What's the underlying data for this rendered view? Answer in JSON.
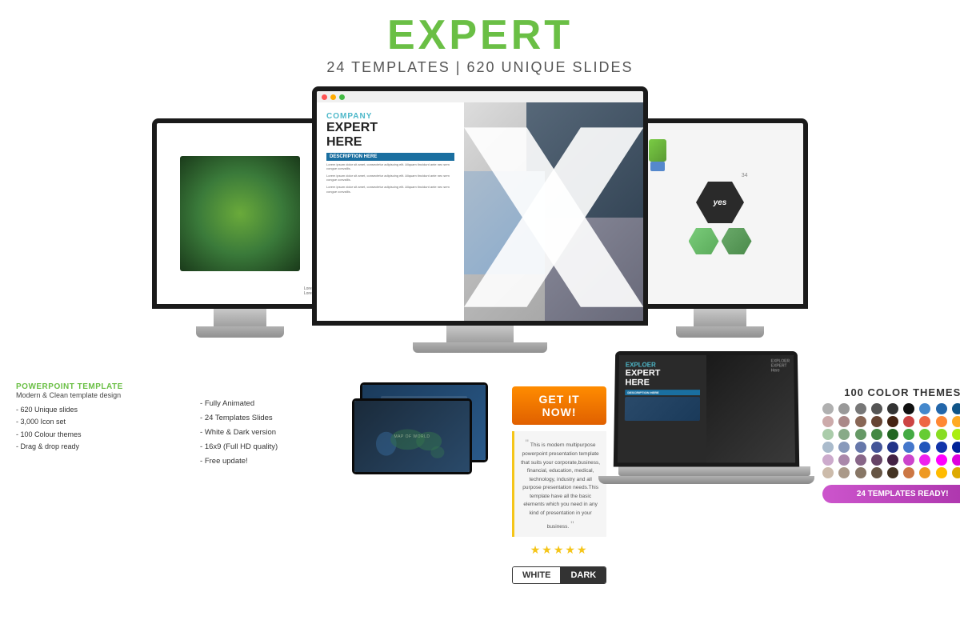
{
  "header": {
    "title": "EXPERT",
    "subtitle": "24 TEMPLATES | 620 UNIQUE SLIDES"
  },
  "slide": {
    "company_label": "COMPANY",
    "expert_label": "EXPERT",
    "here_label": "HERE",
    "desc_title": "DESCRIPTION HERE",
    "desc_text1": "Lorem ipsum dolor sit amet, consectetur adipiscing elit. Aliquam tincidunt ante nec sem congue convallis.",
    "desc_text2": "Lorem ipsum dolor sit amet, consectetur adipiscing elit. Aliquam tincidunt ante nec sem congue convallis.",
    "desc_text3": "Lorem ipsum dolor sit amet, consectetur adipiscing elit. Aliquam tincidunt ante nec sem congue convallis."
  },
  "info_panel": {
    "powerpoint_label": "POWERPOINT TEMPLATE",
    "subtitle": "Modern & Clean template design",
    "list_items": [
      "620 Unique slides",
      "3,000 Icon set",
      "100 Colour themes",
      "Drag & drop ready"
    ]
  },
  "features": {
    "list_items": [
      "Fully Animated",
      "24 Templates Slides",
      "White & Dark version",
      "16x9 (Full HD quality)",
      "Free update!"
    ]
  },
  "cta": {
    "button_label": "GET IT NOW!",
    "quote_text": "This is modern multipurpose powerpoint presentation template that suits your corporate,business, financial, education, medical, technology, industry and all purpose presentation needs.This template have all the basic elements which you need in any kind of presentation in your business.",
    "stars": "★★★★★",
    "white_label": "WHITE",
    "dark_label": "DARK"
  },
  "laptop": {
    "exploer_label": "EXPLOER",
    "expert_label": "EXPERT",
    "here_label": "HERE",
    "desc_label": "DESCRIPTION HERE"
  },
  "color_themes": {
    "title": "100 COLOR THEMES",
    "colors": [
      "#b0b0b0",
      "#999999",
      "#777777",
      "#555555",
      "#333333",
      "#111111",
      "#4488cc",
      "#2266aa",
      "#115588",
      "#003366",
      "#ccaaaa",
      "#aa8888",
      "#886655",
      "#664433",
      "#442211",
      "#cc4444",
      "#ee6644",
      "#ff8833",
      "#ffaa22",
      "#ffcc00",
      "#aaccaa",
      "#88aa88",
      "#669966",
      "#448844",
      "#226622",
      "#44aa44",
      "#66cc33",
      "#88dd22",
      "#aaee11",
      "#ccff00",
      "#aabbcc",
      "#8899bb",
      "#6677aa",
      "#445599",
      "#223388",
      "#4477cc",
      "#2255bb",
      "#1133aa",
      "#002299",
      "#001188",
      "#ccaacc",
      "#aa88aa",
      "#886688",
      "#664466",
      "#442244",
      "#cc44cc",
      "#ee22ee",
      "#ff00ff",
      "#dd00dd",
      "#bb00bb",
      "#ccbbaa",
      "#aa9988",
      "#887766",
      "#665544",
      "#443322",
      "#cc7744",
      "#ee9922",
      "#ffbb00",
      "#ddaa00",
      "#bb8800"
    ]
  },
  "templates_badge": {
    "label": "24 TEMPLATES READY!"
  }
}
